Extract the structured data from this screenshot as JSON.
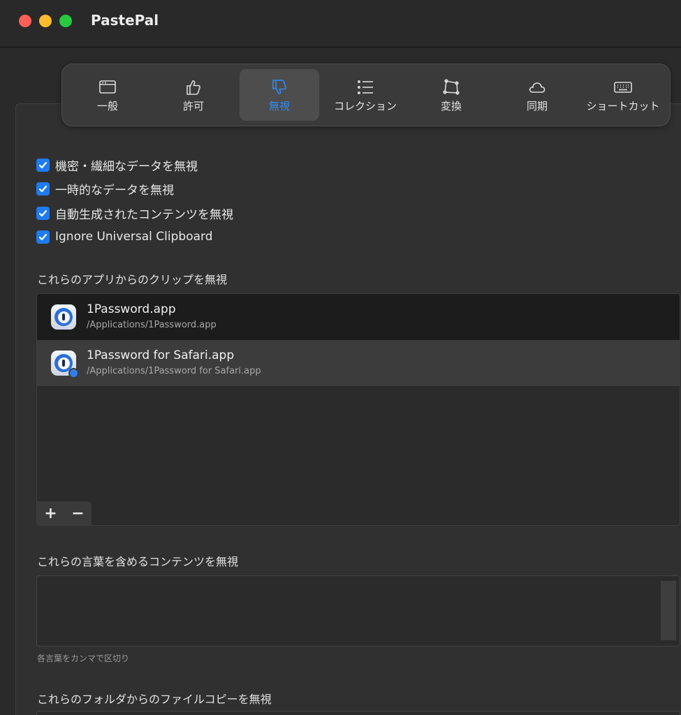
{
  "window": {
    "title": "PastePal"
  },
  "tabs": [
    {
      "label": "一般",
      "icon": "window-icon"
    },
    {
      "label": "許可",
      "icon": "thumbs-up-icon"
    },
    {
      "label": "無視",
      "icon": "thumbs-down-icon",
      "active": true
    },
    {
      "label": "コレクション",
      "icon": "list-icon"
    },
    {
      "label": "変換",
      "icon": "shape-icon"
    },
    {
      "label": "同期",
      "icon": "cloud-icon"
    },
    {
      "label": "ショートカット",
      "icon": "keyboard-icon"
    }
  ],
  "options": [
    {
      "label": "機密・繊細なデータを無視",
      "checked": true
    },
    {
      "label": "一時的なデータを無視",
      "checked": true
    },
    {
      "label": "自動生成されたコンテンツを無視",
      "checked": true
    },
    {
      "label": "Ignore Universal Clipboard",
      "checked": true
    }
  ],
  "apps_section": {
    "label": "これらのアプリからのクリップを無視",
    "apps": [
      {
        "name": "1Password.app",
        "path": "/Applications/1Password.app"
      },
      {
        "name": "1Password for Safari.app",
        "path": "/Applications/1Password for Safari.app"
      }
    ],
    "add_label": "+",
    "remove_label": "−"
  },
  "words_section": {
    "label": "これらの言葉を含めるコンテンツを無視",
    "value": "",
    "hint": "各言葉をカンマで区切り"
  },
  "folders_section": {
    "label": "これらのフォルダからのファイルコピーを無視"
  },
  "colors": {
    "accent": "#2f8cf5",
    "checkbox": "#1f7bf2",
    "close": "#fe5f57",
    "minimize": "#febc2e",
    "maximize": "#28c840"
  }
}
